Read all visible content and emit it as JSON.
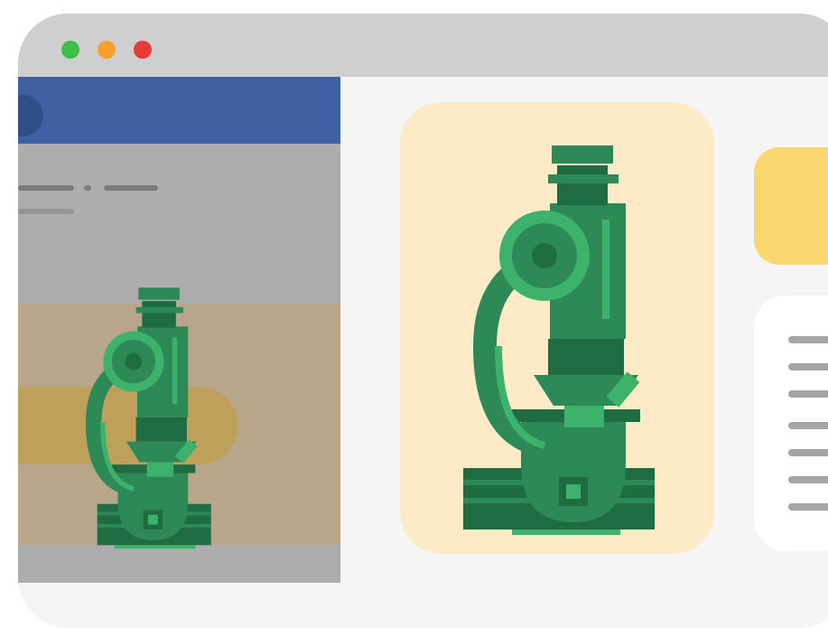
{
  "window": {
    "controls": [
      {
        "name": "close",
        "color": "#e63b3b"
      },
      {
        "name": "minimize",
        "color": "#f59f2c"
      },
      {
        "name": "maximize",
        "color": "#3fbf4a"
      }
    ],
    "colors": {
      "titlebar": "#cfcfcf",
      "background": "#f5f5f5"
    }
  },
  "left_panel": {
    "colors": {
      "header": "#3d61a3",
      "panel": "#adadad",
      "band": "#b8a68c",
      "pill": "#bfa05a"
    },
    "icon": "microscope-icon"
  },
  "main": {
    "hero_icon": "microscope-icon",
    "colors": {
      "hero_card": "#fdebc8",
      "yellow_card": "#f9d76f",
      "white_card": "#ffffff",
      "microscope_dark": "#1f6b42",
      "microscope_mid": "#2d8a56",
      "microscope_light": "#3cb26c"
    }
  }
}
